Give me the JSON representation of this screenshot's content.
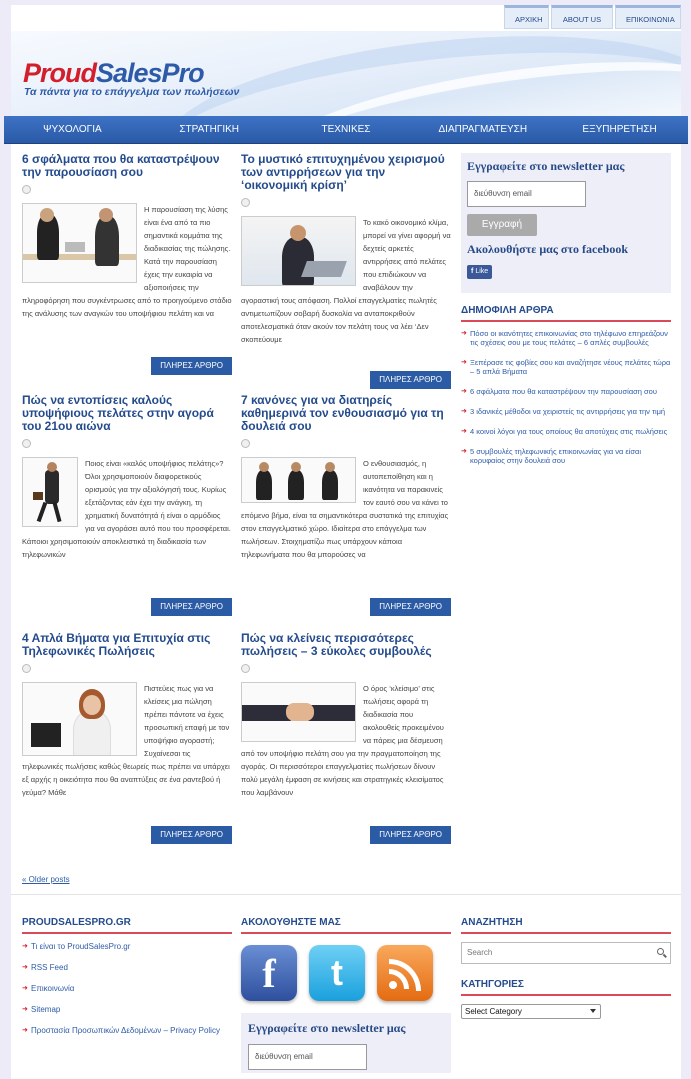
{
  "topnav": [
    "ΑΡΧΙΚΗ",
    "ABOUT US",
    "ΕΠΙΚΟΙΝΩΝΙΑ"
  ],
  "logo": {
    "name_part1": "Proud",
    "name_part2": "SalesPro",
    "tagline": "Τα πάντα για το επάγγελμα των πωλήσεων"
  },
  "mainnav": [
    "ΨΥΧΟΛΟΓΙΑ",
    "ΣΤΡΑΤΗΓΙΚΗ",
    "ΤΕΧΝΙΚΕΣ",
    "ΔΙΑΠΡΑΓΜΑΤΕΥΣΗ",
    "ΕΞΥΠΗΡΕΤΗΣΗ"
  ],
  "read_more": "ΠΛΗΡΕΣ ΑΡΘΡΟ",
  "posts": [
    {
      "title": "6 σφάλματα που θα καταστρέψουν την παρουσίαση σου",
      "excerpt": "Η παρουσίαση της λύσης είναι ένα από τα πιο σημαντικά κομμάτια της διαδικασίας της πώλησης.  Κατά την παρουσίαση έχεις την ευκαιρία να αξιοποιήσεις την πληροφόρηση που συγκέντρωσες από το προηγούμενο στάδιο της ανάλυσης των αναγκών του υποψήφιου πελάτη και να"
    },
    {
      "title": "Το μυστικό επιτυχημένου χειρισμού των αντιρρήσεων για την ‘οικονομική κρίση’",
      "excerpt": "Το κακό οικονομικό κλίμα, μπορεί να γίνει αφορμή να δεχτείς αρκετές αντιρρήσεις από πελάτες που επιδιώκουν να αναβάλουν την αγοραστική τους απόφαση. Πολλοί επαγγελματίες πωλητές αντιμετωπίζουν σοβαρή δυσκολία να ανταποκριθούν αποτελεσματικά όταν ακούν τον πελάτη τους να λέει ‘Δεν σκοπεύουμε"
    },
    {
      "title": "Πώς να εντοπίσεις καλούς υποψήφιους πελάτες στην αγορά του 21ου αιώνα",
      "excerpt": "Ποιος είναι «καλός υποψήφιος πελάτης»?  Όλοι χρησιμοποιούν διαφορετικούς ορισμούς για την αξιολόγησή τους. Κυρίως εξετάζοντας εάν έχει την ανάγκη, τη χρηματική δυνατότητά ή είναι ο αρμόδιος για να αγοράσει αυτό που του προσφέρεται. Κάποιοι χρησιμοποιούν αποκλειστικά τη διαδικασία των τηλεφωνικών"
    },
    {
      "title": "7 κανόνες για να διατηρείς καθημερινά τον ενθουσιασμό για τη δουλειά σου",
      "excerpt": "Ο ενθουσιασμός, η αυτοπεποίθηση και η ικανότητα να παρακινείς τον εαυτό σου να κάνει το επόμενο βήμα, είναι τα σημαντικότερα συστατικά της επιτυχίας στον επαγγελματικό χώρο. Ιδιαίτερα στο επάγγελμα των πωλήσεων. Στοιχηματίζω πως υπάρχουν κάποια τηλεφωνήματα που θα μπορούσες να"
    },
    {
      "title": "4 Απλά Βήματα για Επιτυχία στις Τηλεφωνικές Πωλήσεις",
      "excerpt": "Πιστεύεις πως για να κλείσεις μια πώληση πρέπει πάντοτε να έχεις προσωπική επαφή με τον υποψήφιο αγοραστή; Συχαίνεσαι τις τηλεφωνικές πωλήσεις καθώς θεωρείς πως πρέπει να υπάρχει εξ αρχής η οικειότητα που θα αναπτύξεις σε ένα ραντεβού ή γεύμα? Μάθε"
    },
    {
      "title": "Πώς να κλείνεις περισσότερες πωλήσεις – 3 εύκολες συμβουλές",
      "excerpt": "Ο όρος ‘κλείσιμο’ στις πωλήσεις αφορά τη διαδικασία που ακολουθείς προκειμένου να πάρεις μια δέσμευση από τον υποψήφιο πελάτη σου για την πραγματοποίηση της αγοράς. Οι περισσότεροι επαγγελματίες πωλήσεων δίνουν πολύ μεγάλη έμφαση σε κινήσεις και στρατηγικές κλεισίματος που λαμβάνουν"
    }
  ],
  "newsletter": {
    "title": "Εγγραφείτε στο newsletter μας",
    "email_placeholder": "διεύθυνση email",
    "submit": "Εγγραφή",
    "facebook_title": "Ακολουθήστε μας στο facebook",
    "like": "Like"
  },
  "popular": {
    "heading": "ΔΗΜΟΦΙΛΗ ΑΡΘΡΑ",
    "items": [
      "Πόσο οι ικανότητες επικοινωνίας στο τηλέφωνο επηρεάζουν τις σχέσεις σου με τους πελάτες – 6 απλές συμβουλές",
      "Ξεπέρασε τις φοβίες σου και αναζήτησε νέους πελάτες τώρα – 5 απλά Βήματα",
      "6 σφάλματα που θα καταστρέψουν την παρουσίαση σου",
      "3 ιδανικές μέθοδοι να χειριστείς τις αντιρρήσεις για την τιμή",
      "4 κοινοί λόγοι για τους οποίους θα αποτύχεις στις πωλήσεις",
      "5 συμβουλές τηλεφωνικής επικοινωνίας για να είσαι κορυφαίος στην δουλειά σου"
    ]
  },
  "older_posts": "« Older posts",
  "footer": {
    "col1_heading": "PROUDSALESPRO.GR",
    "col1_items": [
      "Τι είναι το ProudSalesPro.gr",
      "RSS Feed",
      "Επικοινωνία",
      "Sitemap",
      "Προστασία Προσωπικών Δεδομένων – Privacy Policy"
    ],
    "col2_heading": "ΑΚΟΛΟΥΘΗΣΤΕ ΜΑΣ",
    "social_icons": [
      "facebook-icon",
      "twitter-icon",
      "rss-icon"
    ],
    "newsletter_title": "Εγγραφείτε στο newsletter μας",
    "newsletter_placeholder": "διεύθυνση email",
    "col3_search_heading": "ΑΝΑΖΗΤΗΣΗ",
    "search_placeholder": "Search",
    "col3_cat_heading": "ΚΑΤΗΓΟΡΙΕΣ",
    "category_select": "Select Category"
  },
  "colors": {
    "brand_blue": "#2c5ba5",
    "brand_red": "#d31f2b",
    "heading_blue": "#244b8c"
  }
}
